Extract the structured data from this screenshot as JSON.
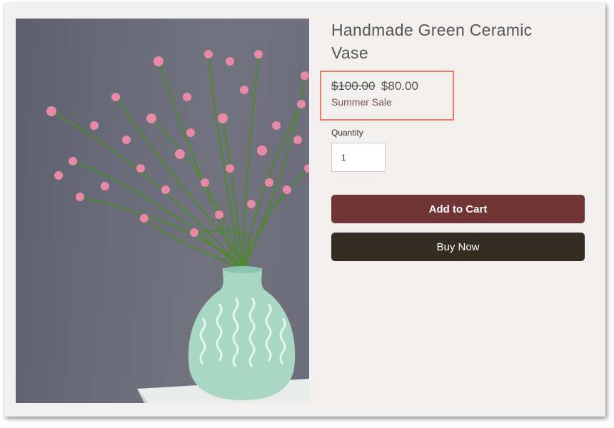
{
  "product": {
    "title": "Handmade Green Ceramic Vase",
    "image_alt": "Green ceramic vase with pink flowers",
    "price": {
      "original": "$100.00",
      "sale": "$80.00",
      "sale_label": "Summer Sale",
      "highlight_color": "#ef7a5e"
    },
    "quantity": {
      "label": "Quantity",
      "value": "1"
    },
    "buttons": {
      "add_to_cart": "Add to Cart",
      "buy_now": "Buy Now"
    },
    "colors": {
      "add_to_cart_bg": "#713535",
      "buy_now_bg": "#352d22",
      "page_bg": "#f2f0ee"
    }
  }
}
